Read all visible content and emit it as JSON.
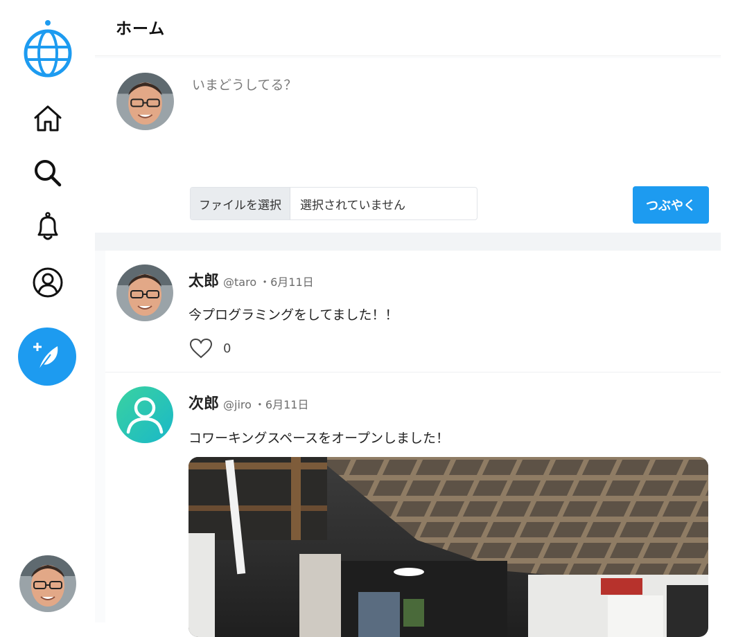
{
  "colors": {
    "accent": "#1d9bf0",
    "background": "#ffffff",
    "divider": "#f2f4f6"
  },
  "sidebar": {
    "icons": [
      "globe-logo-icon",
      "home-icon",
      "search-icon",
      "bell-icon",
      "profile-icon",
      "feather-plus-icon"
    ]
  },
  "header": {
    "title": "ホーム"
  },
  "composer": {
    "placeholder": "いまどうしてる？",
    "file_button": "ファイルを選択",
    "file_status": "選択されていません",
    "submit_label": "つぶやく"
  },
  "posts": [
    {
      "name": "太郎",
      "handle": "@taro",
      "date": "・6月11日",
      "text": "今プログラミングをしてました！！",
      "likes": "0"
    },
    {
      "name": "次郎",
      "handle": "@jiro",
      "date": "・6月11日",
      "text": "コワーキングスペースをオープンしました！"
    }
  ]
}
